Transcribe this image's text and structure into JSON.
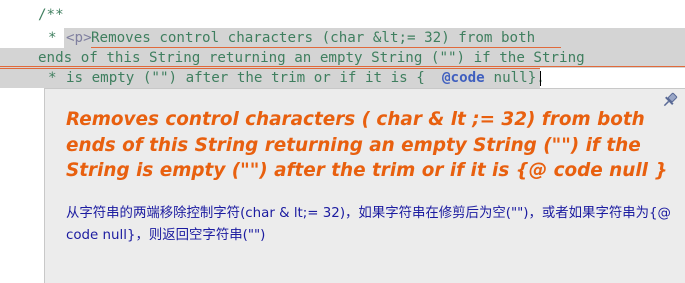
{
  "editor": {
    "lines": [
      {
        "gutter": "/**",
        "text": ""
      },
      {
        "gutter": "*",
        "tag": "<p>",
        "text": "Removes control characters (char &lt;= 32) from both"
      },
      {
        "gutter": "",
        "text": "ends of this String returning an empty String (\"\") if the String"
      },
      {
        "gutter": "*",
        "text_before": "is empty (\"\") after the trim or if it is {",
        "code_keyword": "@code",
        "text_after": " null}."
      }
    ]
  },
  "tooltip": {
    "english": "Removes control characters ( char & lt ;= 32) from both ends of this String returning an empty String (\"\") if the String is empty (\"\") after the trim or if it is {@ code null }",
    "chinese": "从字符串的两端移除控制字符(char & lt;= 32)，如果字符串在修剪后为空(\"\")，或者如果字符串为{@ code null}，则返回空字符串(\"\")",
    "pin_icon": "pin-icon"
  },
  "colors": {
    "comment": "#3f7f5f",
    "tooltip_english": "#e8600f",
    "tooltip_chinese": "#1b1ba0",
    "tooltip_bg": "#ececec",
    "selection": "#d4d4d4"
  }
}
